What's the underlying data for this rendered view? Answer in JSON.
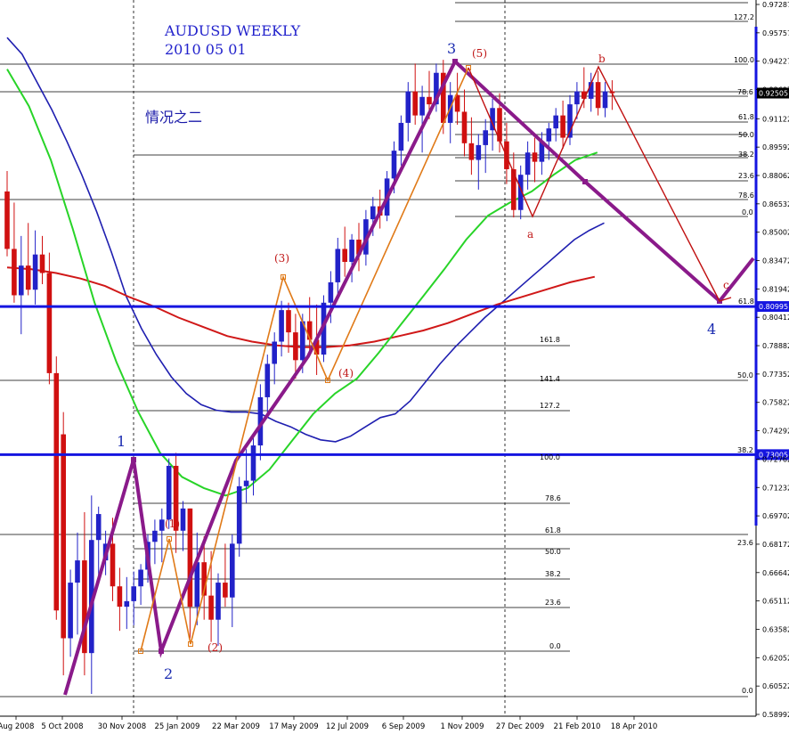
{
  "chart_data": {
    "type": "candlestick",
    "title": "AUDUSD WEEKLY",
    "subtitle": "2010 05 01",
    "note": "情况之二",
    "y_axis": {
      "ticks": [
        "0.97287",
        "0.95757",
        "0.94227",
        "0.92697",
        "0.91122",
        "0.89592",
        "0.88062",
        "0.86532",
        "0.85002",
        "0.83472",
        "0.81942",
        "0.80412",
        "0.78882",
        "0.77352",
        "0.75822",
        "0.74292",
        "0.72762",
        "0.71232",
        "0.69702",
        "0.68172",
        "0.66642",
        "0.65112",
        "0.63582",
        "0.62052",
        "0.60522",
        "0.58992"
      ],
      "tick_values": [
        0.97287,
        0.95757,
        0.94227,
        0.92697,
        0.91122,
        0.89592,
        0.88062,
        0.86532,
        0.85002,
        0.83472,
        0.81942,
        0.80412,
        0.78882,
        0.77352,
        0.75822,
        0.74292,
        0.72762,
        0.71232,
        0.69702,
        0.68172,
        0.66642,
        0.65112,
        0.63582,
        0.62052,
        0.60522,
        0.58992
      ],
      "range": [
        0.5838,
        0.9789
      ]
    },
    "x_axis": {
      "ticks": [
        "Aug 2008",
        "5 Oct 2008",
        "30 Nov 2008",
        "25 Jan 2009",
        "22 Mar 2009",
        "17 May 2009",
        "12 Jul 2009",
        "6 Sep 2009",
        "1 Nov 2009",
        "27 Dec 2009",
        "21 Feb 2010",
        "18 Apr 2010"
      ],
      "tick_index": [
        0,
        8,
        16,
        24,
        32,
        40,
        48,
        56,
        64,
        72,
        80,
        88
      ]
    },
    "current_price": {
      "label": "0.92505",
      "value": 0.92505
    },
    "horizontal_levels": [
      {
        "label": "0.80995",
        "value": 0.80995
      },
      {
        "label": "0.73005",
        "value": 0.73005
      }
    ],
    "candles": [
      {
        "o": 0.872,
        "h": 0.883,
        "l": 0.837,
        "c": 0.841
      },
      {
        "o": 0.841,
        "h": 0.866,
        "l": 0.812,
        "c": 0.816
      },
      {
        "o": 0.816,
        "h": 0.848,
        "l": 0.795,
        "c": 0.832
      },
      {
        "o": 0.832,
        "h": 0.855,
        "l": 0.816,
        "c": 0.819
      },
      {
        "o": 0.819,
        "h": 0.851,
        "l": 0.811,
        "c": 0.838
      },
      {
        "o": 0.838,
        "h": 0.848,
        "l": 0.822,
        "c": 0.828
      },
      {
        "o": 0.828,
        "h": 0.839,
        "l": 0.768,
        "c": 0.774
      },
      {
        "o": 0.774,
        "h": 0.783,
        "l": 0.641,
        "c": 0.646
      },
      {
        "o": 0.741,
        "h": 0.753,
        "l": 0.611,
        "c": 0.631
      },
      {
        "o": 0.631,
        "h": 0.668,
        "l": 0.621,
        "c": 0.661
      },
      {
        "o": 0.661,
        "h": 0.688,
        "l": 0.633,
        "c": 0.673
      },
      {
        "o": 0.673,
        "h": 0.699,
        "l": 0.611,
        "c": 0.623
      },
      {
        "o": 0.623,
        "h": 0.708,
        "l": 0.601,
        "c": 0.684
      },
      {
        "o": 0.684,
        "h": 0.702,
        "l": 0.661,
        "c": 0.698
      },
      {
        "o": 0.673,
        "h": 0.689,
        "l": 0.665,
        "c": 0.682
      },
      {
        "o": 0.682,
        "h": 0.696,
        "l": 0.651,
        "c": 0.659
      },
      {
        "o": 0.659,
        "h": 0.669,
        "l": 0.635,
        "c": 0.648
      },
      {
        "o": 0.648,
        "h": 0.664,
        "l": 0.636,
        "c": 0.651
      },
      {
        "o": 0.651,
        "h": 0.667,
        "l": 0.638,
        "c": 0.659
      },
      {
        "o": 0.659,
        "h": 0.671,
        "l": 0.649,
        "c": 0.668
      },
      {
        "o": 0.668,
        "h": 0.687,
        "l": 0.661,
        "c": 0.683
      },
      {
        "o": 0.683,
        "h": 0.695,
        "l": 0.671,
        "c": 0.689
      },
      {
        "o": 0.689,
        "h": 0.701,
        "l": 0.672,
        "c": 0.695
      },
      {
        "o": 0.695,
        "h": 0.728,
        "l": 0.69,
        "c": 0.724
      },
      {
        "o": 0.724,
        "h": 0.731,
        "l": 0.677,
        "c": 0.689
      },
      {
        "o": 0.689,
        "h": 0.705,
        "l": 0.678,
        "c": 0.701
      },
      {
        "o": 0.701,
        "h": 0.695,
        "l": 0.631,
        "c": 0.648
      },
      {
        "o": 0.648,
        "h": 0.688,
        "l": 0.638,
        "c": 0.672
      },
      {
        "o": 0.672,
        "h": 0.686,
        "l": 0.641,
        "c": 0.654
      },
      {
        "o": 0.654,
        "h": 0.678,
        "l": 0.629,
        "c": 0.641
      },
      {
        "o": 0.641,
        "h": 0.666,
        "l": 0.627,
        "c": 0.661
      },
      {
        "o": 0.661,
        "h": 0.682,
        "l": 0.648,
        "c": 0.653
      },
      {
        "o": 0.653,
        "h": 0.687,
        "l": 0.637,
        "c": 0.682
      },
      {
        "o": 0.682,
        "h": 0.718,
        "l": 0.675,
        "c": 0.713
      },
      {
        "o": 0.713,
        "h": 0.733,
        "l": 0.704,
        "c": 0.716
      },
      {
        "o": 0.716,
        "h": 0.741,
        "l": 0.708,
        "c": 0.735
      },
      {
        "o": 0.735,
        "h": 0.768,
        "l": 0.727,
        "c": 0.761
      },
      {
        "o": 0.761,
        "h": 0.784,
        "l": 0.752,
        "c": 0.779
      },
      {
        "o": 0.779,
        "h": 0.796,
        "l": 0.768,
        "c": 0.791
      },
      {
        "o": 0.791,
        "h": 0.813,
        "l": 0.783,
        "c": 0.808
      },
      {
        "o": 0.808,
        "h": 0.812,
        "l": 0.785,
        "c": 0.796
      },
      {
        "o": 0.796,
        "h": 0.806,
        "l": 0.771,
        "c": 0.781
      },
      {
        "o": 0.781,
        "h": 0.806,
        "l": 0.774,
        "c": 0.802
      },
      {
        "o": 0.802,
        "h": 0.815,
        "l": 0.786,
        "c": 0.792
      },
      {
        "o": 0.792,
        "h": 0.811,
        "l": 0.773,
        "c": 0.784
      },
      {
        "o": 0.784,
        "h": 0.816,
        "l": 0.78,
        "c": 0.812
      },
      {
        "o": 0.812,
        "h": 0.829,
        "l": 0.801,
        "c": 0.823
      },
      {
        "o": 0.823,
        "h": 0.847,
        "l": 0.816,
        "c": 0.841
      },
      {
        "o": 0.841,
        "h": 0.853,
        "l": 0.826,
        "c": 0.834
      },
      {
        "o": 0.834,
        "h": 0.849,
        "l": 0.823,
        "c": 0.846
      },
      {
        "o": 0.846,
        "h": 0.855,
        "l": 0.829,
        "c": 0.838
      },
      {
        "o": 0.838,
        "h": 0.862,
        "l": 0.832,
        "c": 0.857
      },
      {
        "o": 0.857,
        "h": 0.869,
        "l": 0.848,
        "c": 0.864
      },
      {
        "o": 0.864,
        "h": 0.873,
        "l": 0.852,
        "c": 0.859
      },
      {
        "o": 0.859,
        "h": 0.883,
        "l": 0.856,
        "c": 0.879
      },
      {
        "o": 0.879,
        "h": 0.899,
        "l": 0.871,
        "c": 0.894
      },
      {
        "o": 0.894,
        "h": 0.913,
        "l": 0.886,
        "c": 0.909
      },
      {
        "o": 0.909,
        "h": 0.931,
        "l": 0.899,
        "c": 0.926
      },
      {
        "o": 0.926,
        "h": 0.941,
        "l": 0.908,
        "c": 0.913
      },
      {
        "o": 0.913,
        "h": 0.929,
        "l": 0.893,
        "c": 0.923
      },
      {
        "o": 0.923,
        "h": 0.937,
        "l": 0.911,
        "c": 0.919
      },
      {
        "o": 0.919,
        "h": 0.941,
        "l": 0.915,
        "c": 0.936
      },
      {
        "o": 0.936,
        "h": 0.943,
        "l": 0.903,
        "c": 0.909
      },
      {
        "o": 0.909,
        "h": 0.931,
        "l": 0.898,
        "c": 0.924
      },
      {
        "o": 0.924,
        "h": 0.936,
        "l": 0.908,
        "c": 0.915
      },
      {
        "o": 0.915,
        "h": 0.927,
        "l": 0.891,
        "c": 0.898
      },
      {
        "o": 0.898,
        "h": 0.912,
        "l": 0.881,
        "c": 0.889
      },
      {
        "o": 0.889,
        "h": 0.903,
        "l": 0.873,
        "c": 0.897
      },
      {
        "o": 0.897,
        "h": 0.911,
        "l": 0.882,
        "c": 0.905
      },
      {
        "o": 0.905,
        "h": 0.922,
        "l": 0.894,
        "c": 0.917
      },
      {
        "o": 0.917,
        "h": 0.925,
        "l": 0.893,
        "c": 0.899
      },
      {
        "o": 0.899,
        "h": 0.909,
        "l": 0.876,
        "c": 0.884
      },
      {
        "o": 0.884,
        "h": 0.893,
        "l": 0.858,
        "c": 0.862
      },
      {
        "o": 0.862,
        "h": 0.886,
        "l": 0.857,
        "c": 0.881
      },
      {
        "o": 0.881,
        "h": 0.899,
        "l": 0.873,
        "c": 0.893
      },
      {
        "o": 0.893,
        "h": 0.901,
        "l": 0.877,
        "c": 0.888
      },
      {
        "o": 0.888,
        "h": 0.904,
        "l": 0.881,
        "c": 0.899
      },
      {
        "o": 0.899,
        "h": 0.909,
        "l": 0.889,
        "c": 0.906
      },
      {
        "o": 0.906,
        "h": 0.917,
        "l": 0.899,
        "c": 0.913
      },
      {
        "o": 0.913,
        "h": 0.921,
        "l": 0.895,
        "c": 0.901
      },
      {
        "o": 0.901,
        "h": 0.924,
        "l": 0.897,
        "c": 0.919
      },
      {
        "o": 0.919,
        "h": 0.931,
        "l": 0.911,
        "c": 0.926
      },
      {
        "o": 0.926,
        "h": 0.939,
        "l": 0.917,
        "c": 0.922
      },
      {
        "o": 0.922,
        "h": 0.936,
        "l": 0.915,
        "c": 0.931
      },
      {
        "o": 0.931,
        "h": 0.937,
        "l": 0.913,
        "c": 0.917
      },
      {
        "o": 0.917,
        "h": 0.931,
        "l": 0.912,
        "c": 0.926
      },
      {
        "o": 0.926,
        "h": 0.932,
        "l": 0.916,
        "c": 0.925
      }
    ],
    "moving_averages": [
      {
        "color": "#1f1fb0",
        "values": [
          0.955,
          0.946,
          0.931,
          0.916,
          0.899,
          0.881,
          0.861,
          0.839,
          0.815,
          0.798,
          0.784,
          0.772,
          0.763,
          0.757,
          0.754,
          0.753,
          0.753,
          0.752,
          0.748,
          0.745,
          0.741,
          0.738,
          0.737,
          0.74,
          0.745,
          0.75,
          0.752,
          0.759,
          0.769,
          0.779,
          0.788,
          0.796,
          0.804,
          0.811,
          0.818,
          0.825,
          0.832,
          0.839,
          0.846,
          0.851,
          0.855
        ]
      },
      {
        "color": "#d01818",
        "values": [
          0.831,
          0.83,
          0.828,
          0.825,
          0.821,
          0.815,
          0.81,
          0.804,
          0.799,
          0.794,
          0.791,
          0.789,
          0.788,
          0.788,
          0.789,
          0.791,
          0.794,
          0.797,
          0.801,
          0.806,
          0.811,
          0.815,
          0.819,
          0.823,
          0.826
        ]
      },
      {
        "color": "#28d428",
        "values": [
          0.938,
          0.918,
          0.889,
          0.852,
          0.812,
          0.78,
          0.753,
          0.731,
          0.718,
          0.712,
          0.708,
          0.712,
          0.722,
          0.737,
          0.752,
          0.763,
          0.771,
          0.785,
          0.8,
          0.815,
          0.83,
          0.846,
          0.859,
          0.866,
          0.872,
          0.881,
          0.889,
          0.893
        ]
      }
    ],
    "fib_labels": {
      "right_upper": [
        "127.2",
        "100.0",
        "78.6",
        "61.8",
        "50.0",
        "38.2",
        "23.6",
        "78.6",
        "0.0",
        "61.8"
      ],
      "middle_ext": [
        "161.8",
        "141.4",
        "127.2",
        "100.0"
      ],
      "lower_retr": [
        "78.6",
        "61.8",
        "50.0",
        "38.2",
        "23.6",
        "0.0"
      ],
      "far_right": [
        "50.0",
        "38.2",
        "23.6",
        "0.0"
      ]
    },
    "wave_labels": {
      "main": [
        "1",
        "2",
        "3",
        "4"
      ],
      "sub": [
        "(1)",
        "(2)",
        "(3)",
        "(4)",
        "(5)",
        "a",
        "b",
        "c"
      ]
    }
  }
}
